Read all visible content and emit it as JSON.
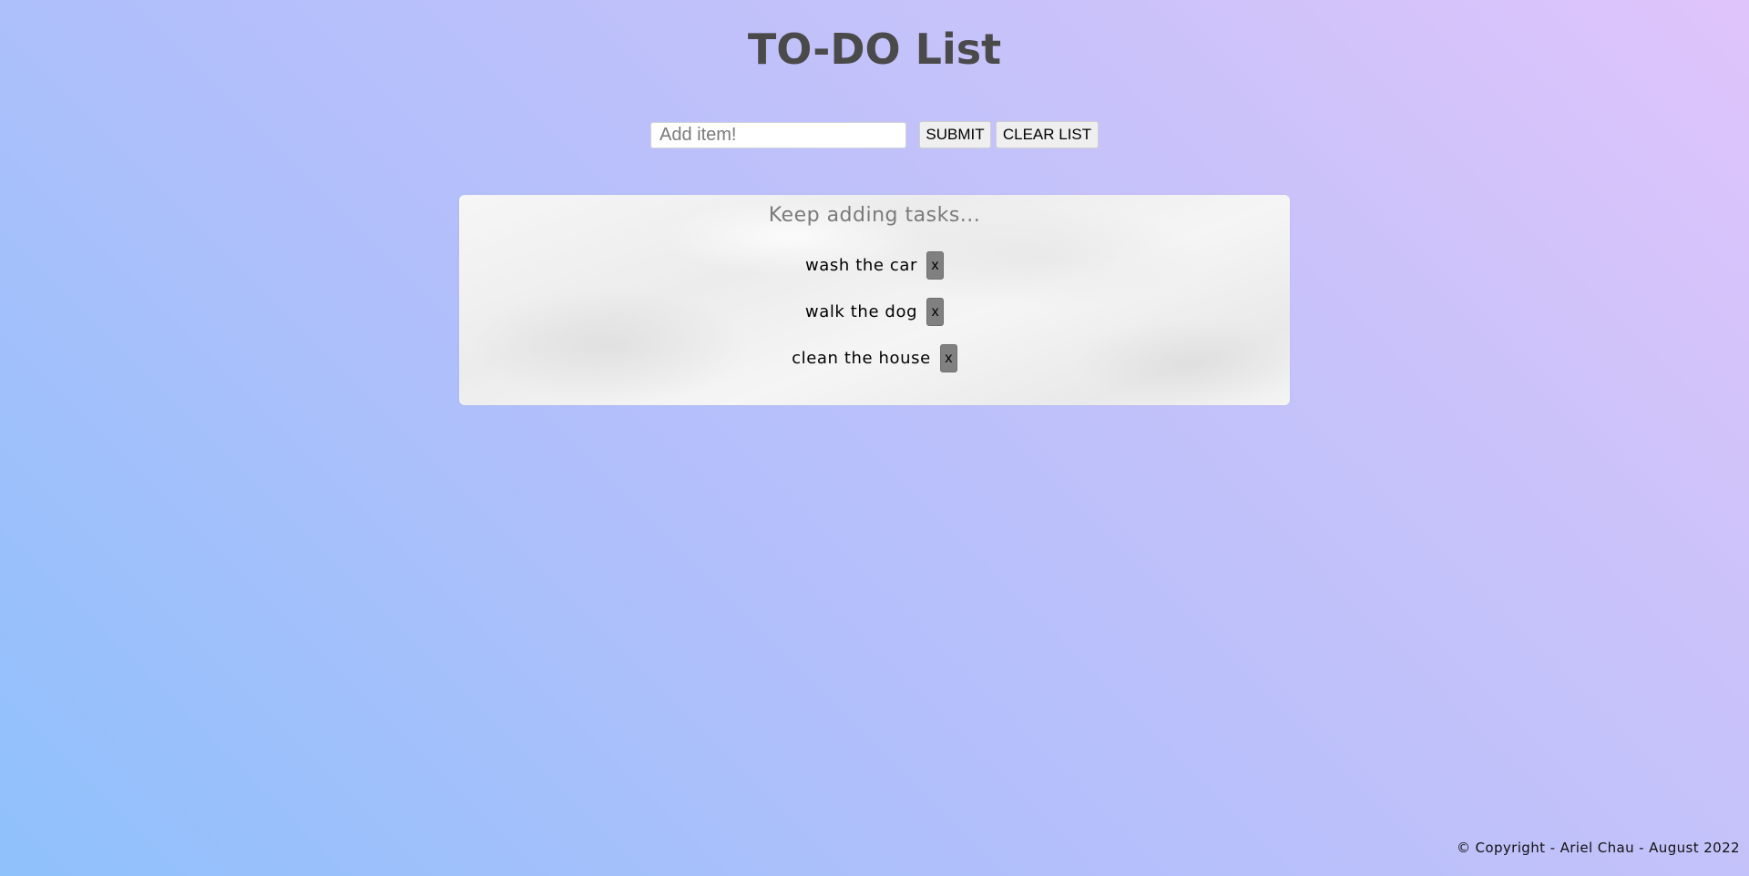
{
  "page": {
    "title": "TO-DO List"
  },
  "form": {
    "input_placeholder": "Add item!",
    "input_value": "",
    "submit_label": "SUBMIT",
    "clear_label": "CLEAR LIST"
  },
  "list": {
    "heading": "Keep adding tasks...",
    "items": [
      {
        "label": "wash the car",
        "delete_label": "x"
      },
      {
        "label": "walk the dog",
        "delete_label": "x"
      },
      {
        "label": "clean the house",
        "delete_label": "x"
      }
    ]
  },
  "footer": {
    "text": "© Copyright - Ariel Chau - August 2022"
  },
  "colors": {
    "title": "#4a4a4a",
    "delete_button": "#808080",
    "heading": "#7a7a7a"
  }
}
